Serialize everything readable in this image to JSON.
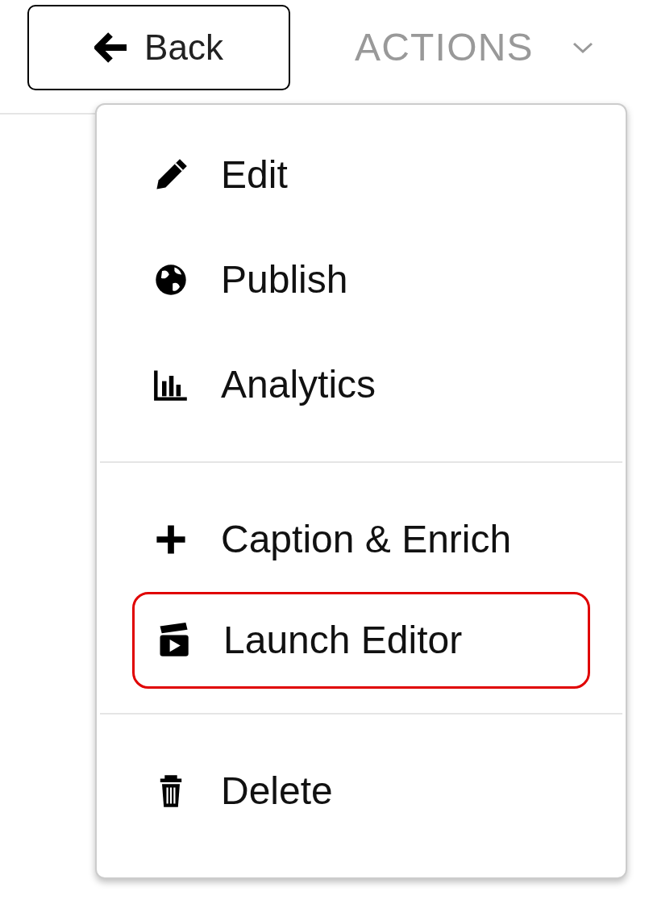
{
  "back_button": {
    "label": "Back"
  },
  "actions_menu": {
    "label": "ACTIONS",
    "expanded": true,
    "groups": [
      {
        "items": [
          {
            "label": "Edit",
            "highlighted": false
          },
          {
            "label": "Publish",
            "highlighted": false
          },
          {
            "label": "Analytics",
            "highlighted": false
          }
        ]
      },
      {
        "items": [
          {
            "label": "Caption & Enrich",
            "highlighted": false
          },
          {
            "label": "Launch Editor",
            "highlighted": true
          }
        ]
      },
      {
        "items": [
          {
            "label": "Delete",
            "highlighted": false
          }
        ]
      }
    ]
  }
}
